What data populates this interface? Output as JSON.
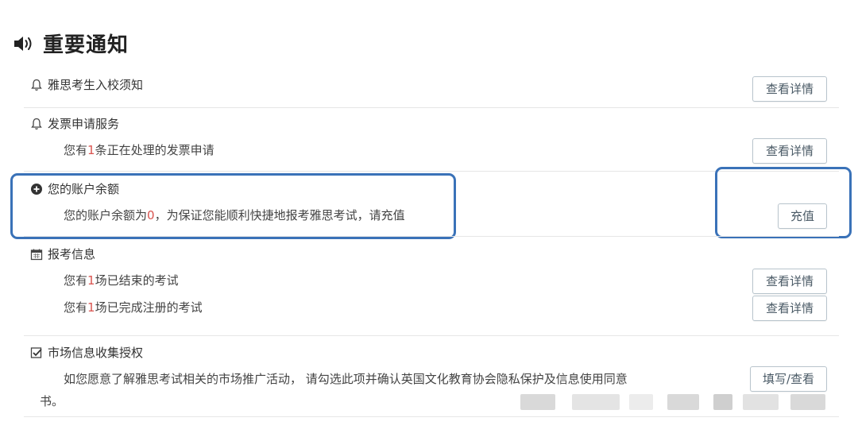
{
  "header": {
    "title": "重要通知",
    "icon": "speaker-icon"
  },
  "items": [
    {
      "id": "ielts-entry",
      "icon": "bell-icon",
      "title": "雅思考生入校须知",
      "button": "查看详情"
    },
    {
      "id": "invoice",
      "icon": "bell-icon",
      "title": "发票申请服务",
      "line_prefix": "您有",
      "line_count": "1",
      "line_suffix": "条正在处理的发票申请",
      "button": "查看详情"
    },
    {
      "id": "balance",
      "icon": "plus-circle-icon",
      "title": "您的账户余额",
      "line_prefix": "您的账户余额为",
      "line_amount": "0",
      "line_suffix": "，为保证您能顺利快捷地报考雅思考试，请充值",
      "button": "充值"
    },
    {
      "id": "registration",
      "icon": "calendar-icon",
      "title": "报考信息",
      "lines": [
        {
          "prefix": "您有",
          "count": "1",
          "suffix": "场已结束的考试",
          "button": "查看详情"
        },
        {
          "prefix": "您有",
          "count": "1",
          "suffix": "场已完成注册的考试",
          "button": "查看详情"
        }
      ]
    },
    {
      "id": "market",
      "icon": "checkbox-icon",
      "title": "市场信息收集授权",
      "text_line1": "如您愿意了解雅思考试相关的市场推广活动， 请勾选此项并确认英国文化教育协会隐私保护及信息使用同意",
      "text_line2": "书。",
      "button": "填写/查看"
    }
  ],
  "colors": {
    "highlight": "#d9534f",
    "focus_border": "#3a72b8",
    "button_border": "#b8c4cc"
  }
}
